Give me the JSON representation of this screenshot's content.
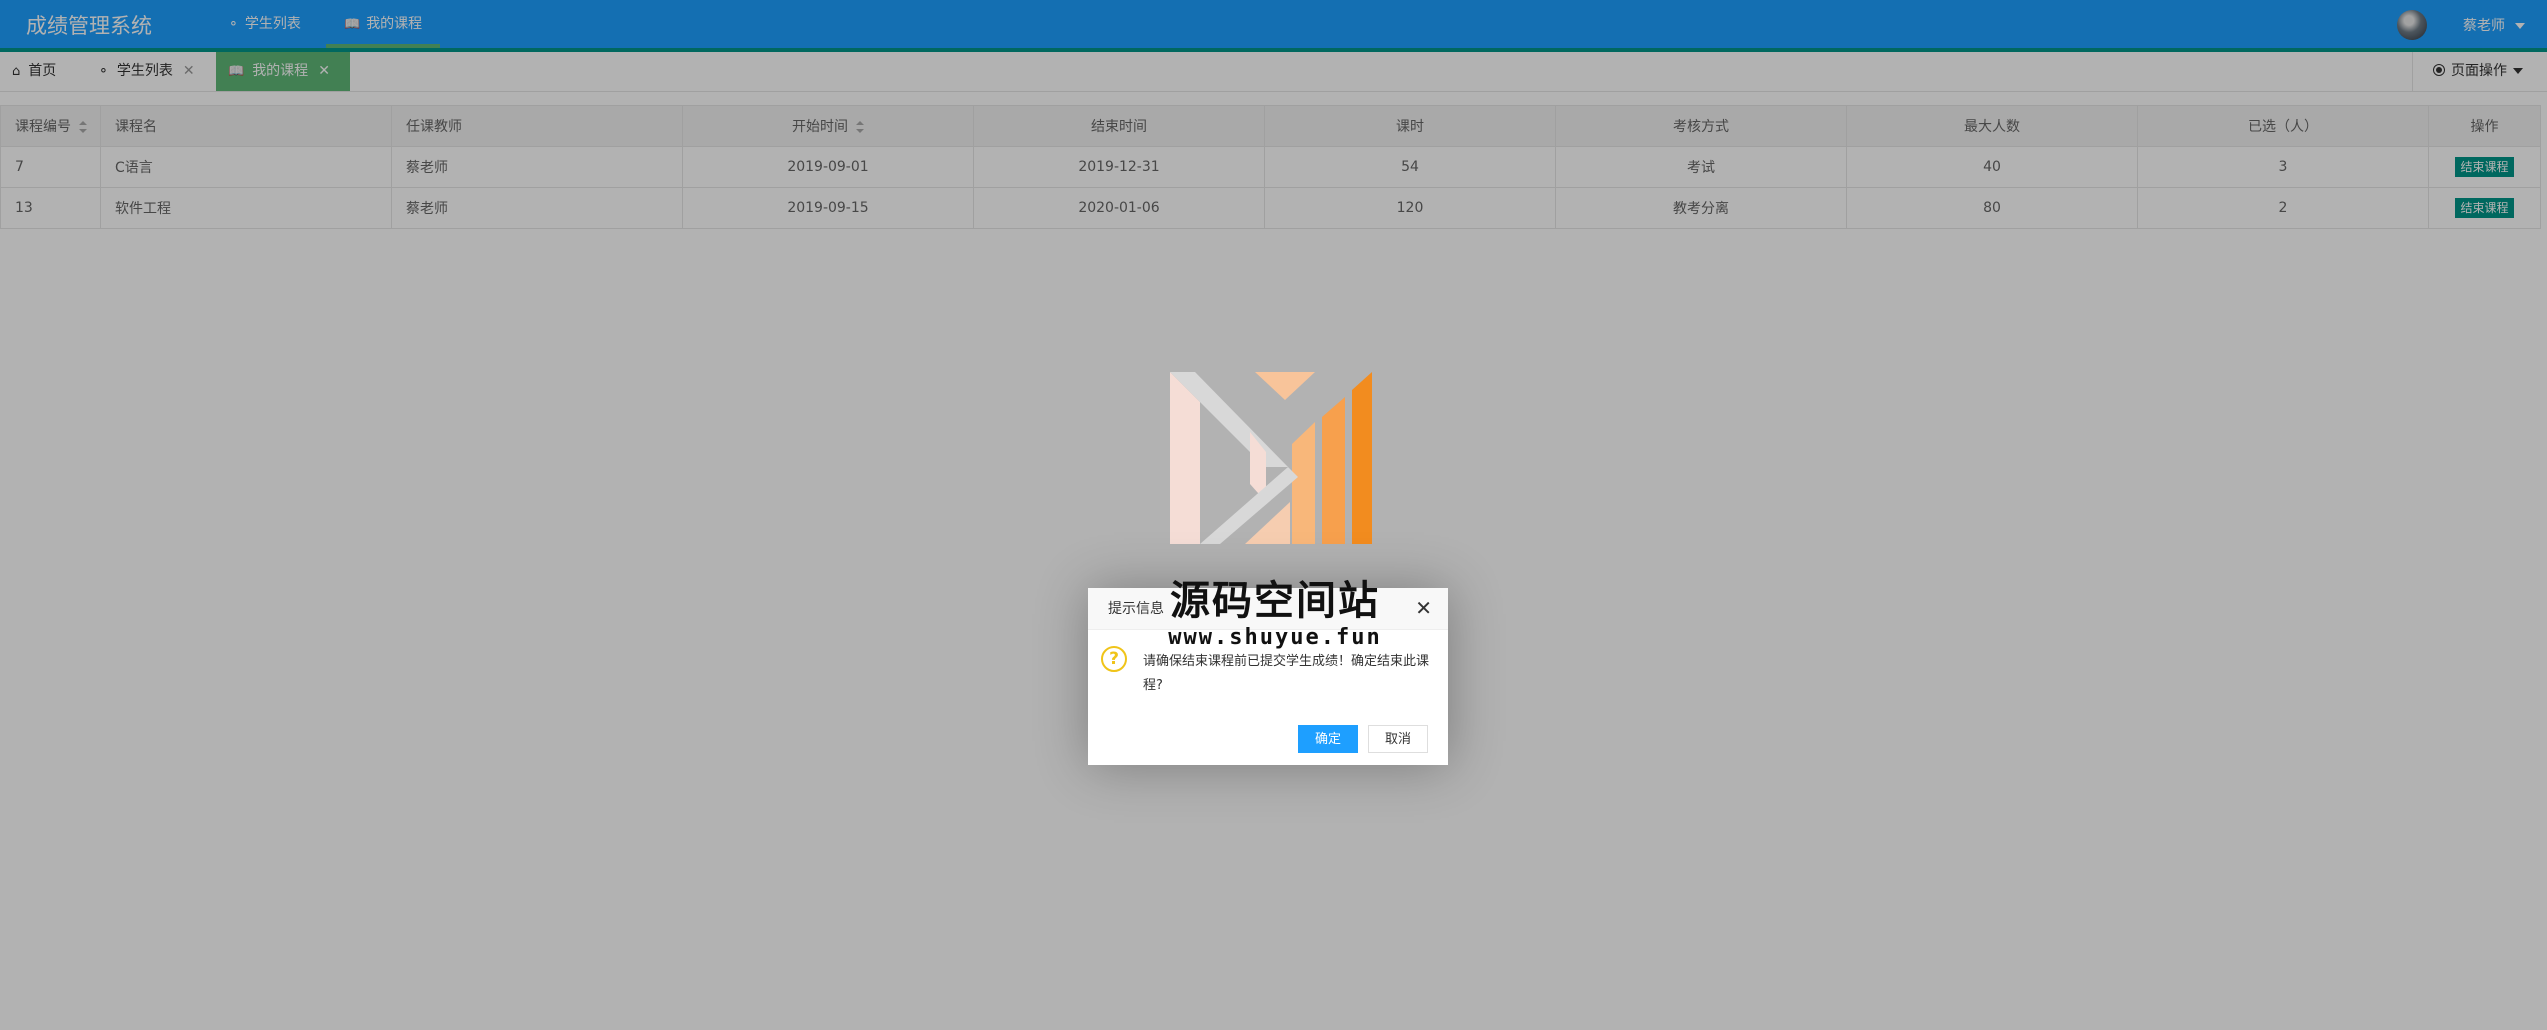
{
  "app": {
    "title": "成绩管理系统",
    "nav": [
      {
        "label": "学生列表",
        "icon": "users-icon",
        "active": false
      },
      {
        "label": "我的课程",
        "icon": "book-icon",
        "active": true
      }
    ],
    "user": {
      "name": "蔡老师"
    }
  },
  "tabs": {
    "items": [
      {
        "label": "首页",
        "icon": "home-icon"
      },
      {
        "label": "学生列表",
        "icon": "users-icon",
        "closable": true
      },
      {
        "label": "我的课程",
        "icon": "book-icon",
        "closable": true,
        "active": true
      }
    ],
    "page_ops_label": "页面操作"
  },
  "table": {
    "columns": [
      "课程编号",
      "课程名",
      "任课教师",
      "开始时间",
      "结束时间",
      "课时",
      "考核方式",
      "最大人数",
      "已选（人）",
      "操作"
    ],
    "rows": [
      {
        "id": "7",
        "name": "C语言",
        "teacher": "蔡老师",
        "start": "2019-09-01",
        "end": "2019-12-31",
        "hours": "54",
        "exam": "考试",
        "max": "40",
        "selected": "3",
        "action": "结束课程"
      },
      {
        "id": "13",
        "name": "软件工程",
        "teacher": "蔡老师",
        "start": "2019-09-15",
        "end": "2020-01-06",
        "hours": "120",
        "exam": "教考分离",
        "max": "80",
        "selected": "2",
        "action": "结束课程"
      }
    ]
  },
  "watermark": {
    "title": "源码空间站",
    "url": "www.shuyue.fun"
  },
  "dialog": {
    "title": "提示信息",
    "message": "请确保结束课程前已提交学生成绩！确定结束此课程?",
    "ok_label": "确定",
    "cancel_label": "取消"
  },
  "colors": {
    "header": "#1e9fff",
    "header_bottom": "#009688",
    "tab_active": "#5fb878",
    "action_button": "#009688",
    "dialog_ok": "#1e9fff"
  }
}
